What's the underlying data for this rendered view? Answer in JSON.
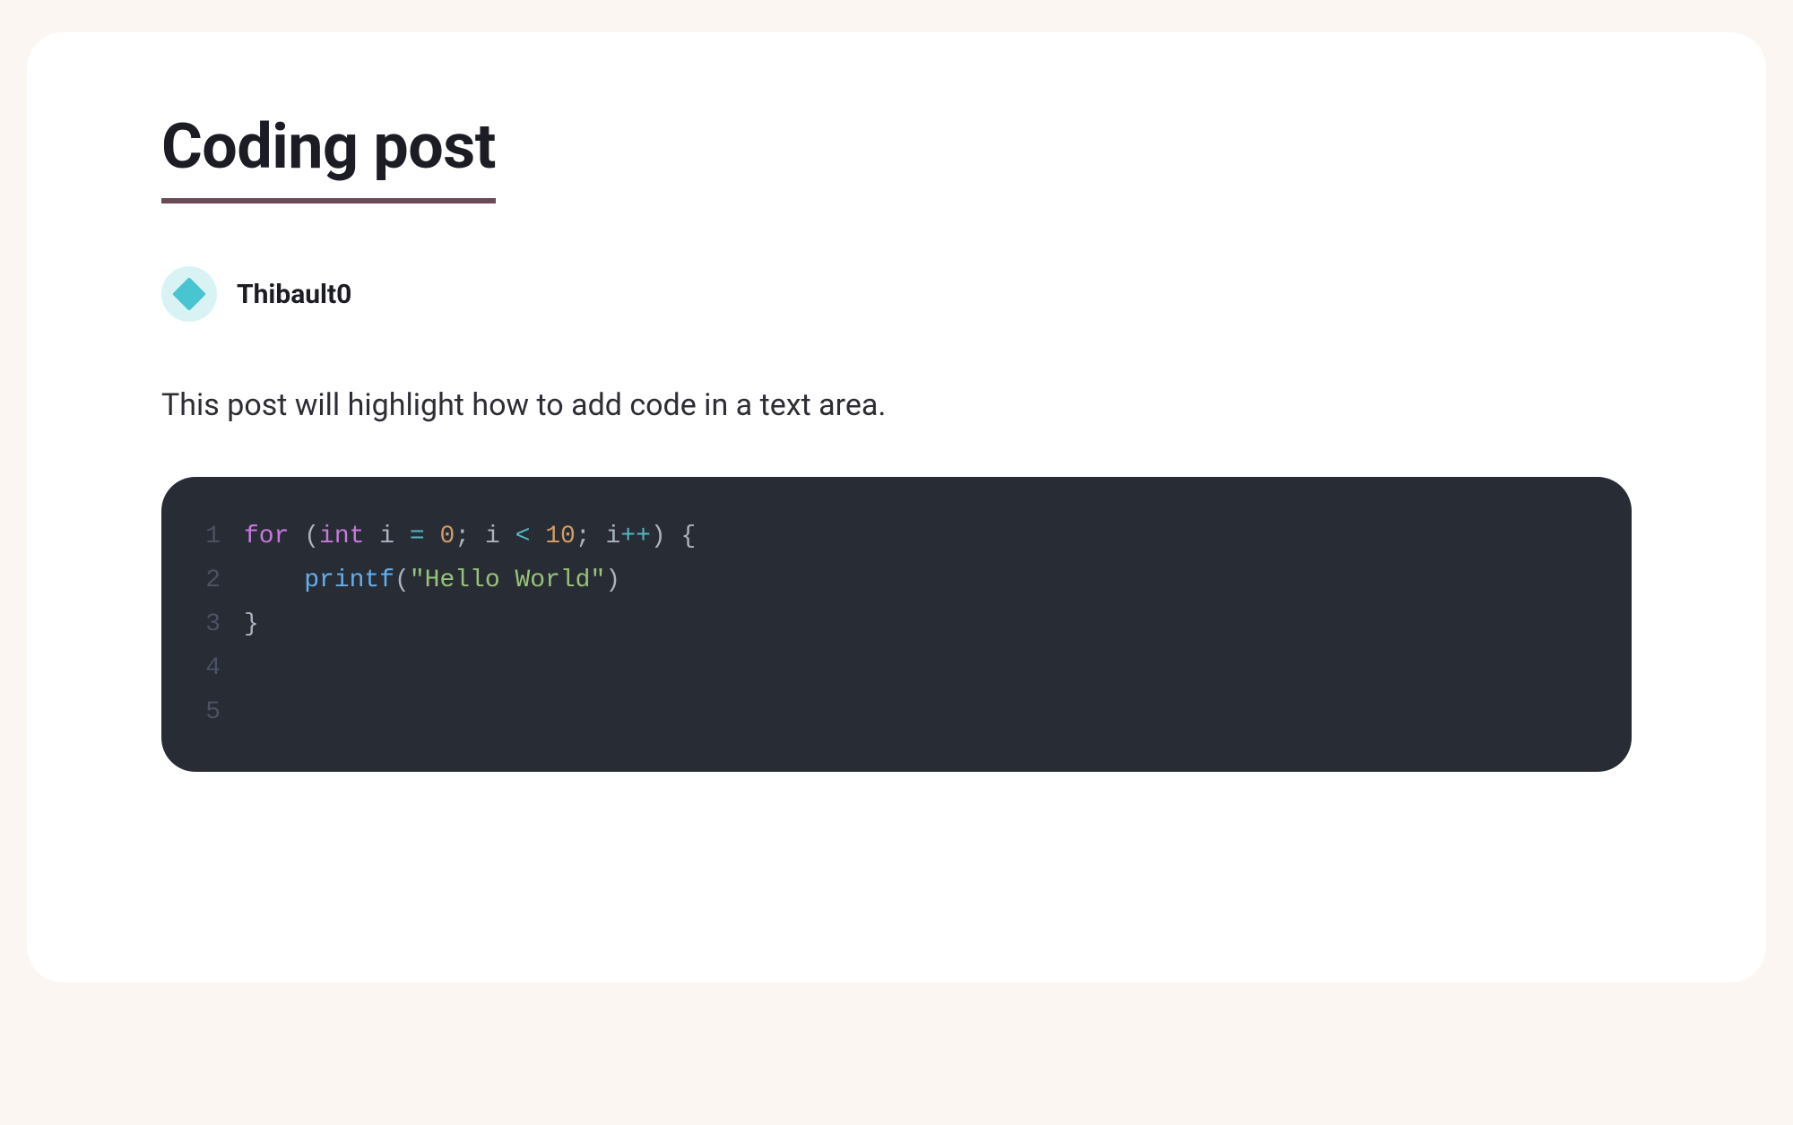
{
  "post": {
    "title": "Coding post",
    "author": "Thibault0",
    "body": "This post will highlight how to add code in a text area."
  },
  "code": {
    "line_numbers": [
      "1",
      "2",
      "3",
      "4",
      "5"
    ],
    "lines": {
      "l1": {
        "keyword_for": "for",
        "paren_open": "(",
        "type_int": "int",
        "var_i_decl": "i",
        "op_assign": "=",
        "num_zero": "0",
        "semi1": ";",
        "var_i_cond": "i",
        "op_lt": "<",
        "num_ten": "10",
        "semi2": ";",
        "var_i_inc": "i",
        "op_inc": "++",
        "paren_close": ")",
        "brace_open": "{"
      },
      "l2": {
        "func_printf": "printf",
        "paren_open": "(",
        "string_hello": "\"Hello World\"",
        "paren_close": ")"
      },
      "l3": {
        "brace_close": "}"
      }
    }
  }
}
